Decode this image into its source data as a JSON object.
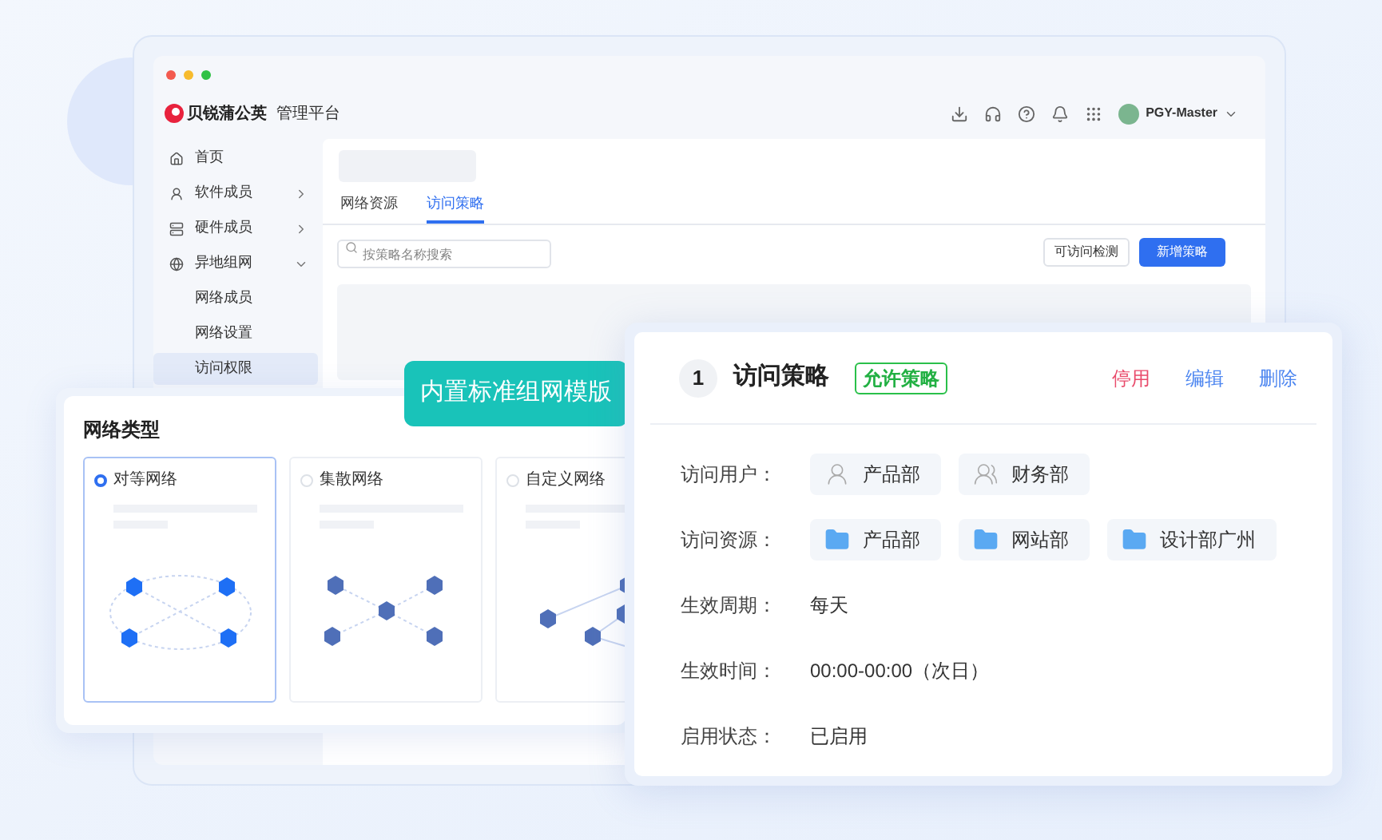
{
  "app": {
    "brand": "贝锐蒲公英",
    "subtitle": "管理平台",
    "user": "PGY-Master"
  },
  "sidebar": {
    "items": [
      {
        "label": "首页",
        "kind": "home"
      },
      {
        "label": "软件成员",
        "kind": "software",
        "expanded": false
      },
      {
        "label": "硬件成员",
        "kind": "hardware",
        "expanded": false
      },
      {
        "label": "异地组网",
        "kind": "network",
        "expanded": true,
        "children": [
          {
            "label": "网络成员",
            "selected": false
          },
          {
            "label": "网络设置",
            "selected": false
          },
          {
            "label": "访问权限",
            "selected": true
          }
        ]
      }
    ]
  },
  "tabs": [
    {
      "label": "网络资源",
      "selected": false
    },
    {
      "label": "访问策略",
      "selected": true
    }
  ],
  "search": {
    "placeholder": "按策略名称搜索"
  },
  "buttons": [
    {
      "label": "可访问检测",
      "kind": "secondary"
    },
    {
      "label": "新增策略",
      "kind": "primary"
    }
  ],
  "banner": "内置标准组网模版",
  "network_type": {
    "title": "网络类型",
    "options": [
      {
        "label": "对等网络",
        "kind": "peer",
        "selected": true
      },
      {
        "label": "集散网络",
        "kind": "hub",
        "selected": false
      },
      {
        "label": "自定义网络",
        "kind": "mesh",
        "selected": false
      }
    ]
  },
  "policy": {
    "index": "1",
    "title": "访问策略",
    "tag": "允许策略",
    "actions": [
      {
        "label": "停用",
        "kind": "danger"
      },
      {
        "label": "编辑",
        "kind": "normal"
      },
      {
        "label": "删除",
        "kind": "normal"
      }
    ],
    "fields": [
      {
        "label": "访问用户：",
        "kind": "chips",
        "items": [
          {
            "label": "产品部",
            "kind": "user"
          },
          {
            "label": "财务部",
            "kind": "users"
          }
        ]
      },
      {
        "label": "访问资源：",
        "kind": "chips",
        "items": [
          {
            "label": "产品部",
            "kind": "folder"
          },
          {
            "label": "网站部",
            "kind": "folder"
          },
          {
            "label": "设计部广州",
            "kind": "folder"
          }
        ]
      },
      {
        "label": "生效周期：",
        "kind": "text",
        "value": "每天"
      },
      {
        "label": "生效时间：",
        "kind": "text",
        "value": "00:00-00:00（次日）"
      },
      {
        "label": "启用状态：",
        "kind": "text",
        "value": "已启用"
      }
    ]
  }
}
